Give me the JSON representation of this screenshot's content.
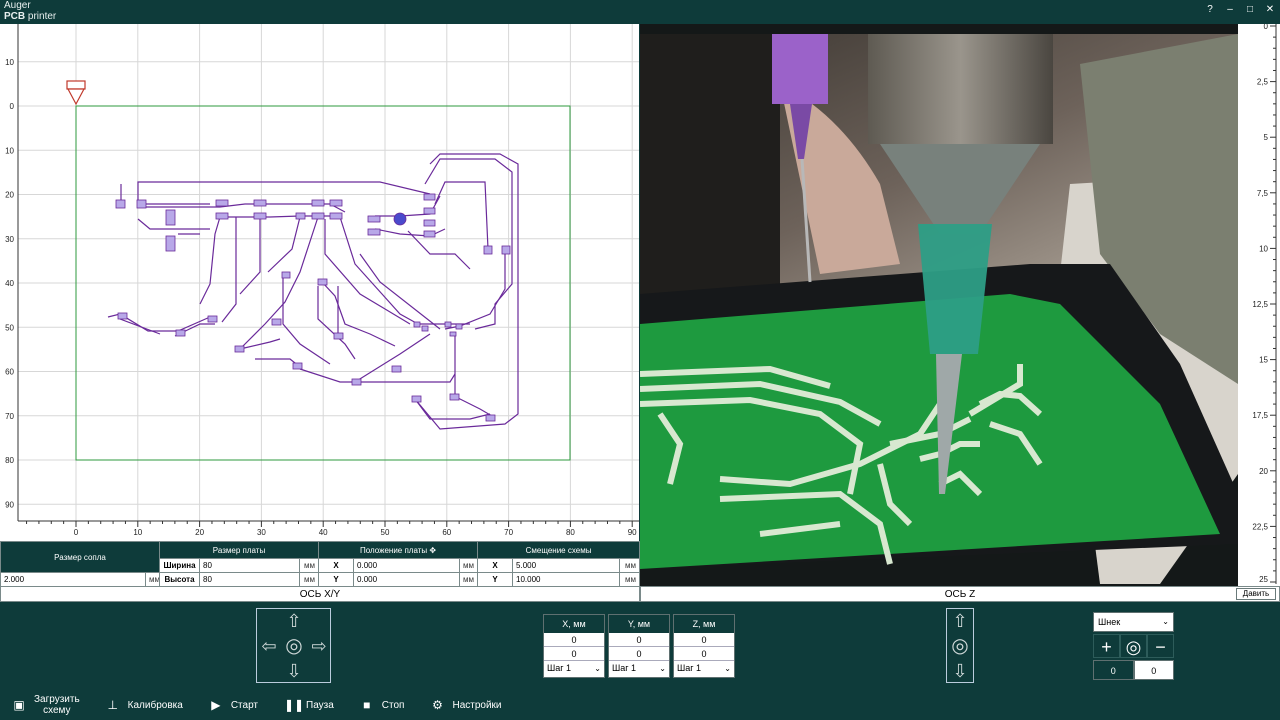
{
  "window": {
    "app_name": "Auger",
    "app_sub_bold": "PCB",
    "app_sub_rest": " printer",
    "buttons": [
      "?",
      "–",
      "□",
      "✕"
    ]
  },
  "xy_plot": {
    "x_ticks": [
      "0",
      "10",
      "20",
      "30",
      "40",
      "50",
      "60",
      "70",
      "80",
      "90"
    ],
    "y_ticks": [
      "10",
      "0",
      "10",
      "20",
      "30",
      "40",
      "50",
      "60",
      "70",
      "80",
      "90"
    ],
    "board_width_mm": 80,
    "board_height_mm": 80,
    "x_range": [
      -12,
      91
    ],
    "y_range": [
      -19,
      93
    ],
    "colors": {
      "board": "#2e9a3e",
      "trace": "#6a2a9a",
      "pad": "#b8a8e8",
      "nozzle": "#c0392b",
      "grid": "#d7d7d7"
    }
  },
  "params": {
    "nozzle_header": "Размер сопла",
    "nozzle_value": "2.000",
    "board_size_header": "Размер платы",
    "width_label": "Ширина",
    "width_value": "80",
    "height_label": "Высота",
    "height_value": "80",
    "board_pos_header": "Положение платы",
    "pos_x_label": "X",
    "pos_x_value": "0.000",
    "pos_y_label": "Y",
    "pos_y_value": "0.000",
    "offset_header": "Смещение схемы",
    "off_x_label": "X",
    "off_x_value": "5.000",
    "off_y_label": "Y",
    "off_y_value": "10.000",
    "unit": "мм"
  },
  "axis_xy_label": "ОСЬ X/Y",
  "axis_z_label": "ОСЬ Z",
  "z_scale": {
    "ticks": [
      "0",
      "2,5",
      "5",
      "7,5",
      "10",
      "12,5",
      "15",
      "17,5",
      "20",
      "22,5",
      "25"
    ]
  },
  "press_button": "Давить",
  "coords": [
    {
      "header": "X, мм",
      "v1": "0",
      "v2": "0",
      "step": "Шаг 1"
    },
    {
      "header": "Y, мм",
      "v1": "0",
      "v2": "0",
      "step": "Шаг 1"
    },
    {
      "header": "Z, мм",
      "v1": "0",
      "v2": "0",
      "step": "Шаг 1"
    }
  ],
  "auger": {
    "select_value": "Шнек",
    "plus": "+",
    "minus": "−",
    "value1": "0",
    "value2": "0"
  },
  "toolbar": {
    "load_line1": "Загрузить",
    "load_line2": "схему",
    "calibrate": "Калибровка",
    "start": "Старт",
    "pause": "Пауза",
    "stop": "Стоп",
    "settings": "Настройки"
  }
}
